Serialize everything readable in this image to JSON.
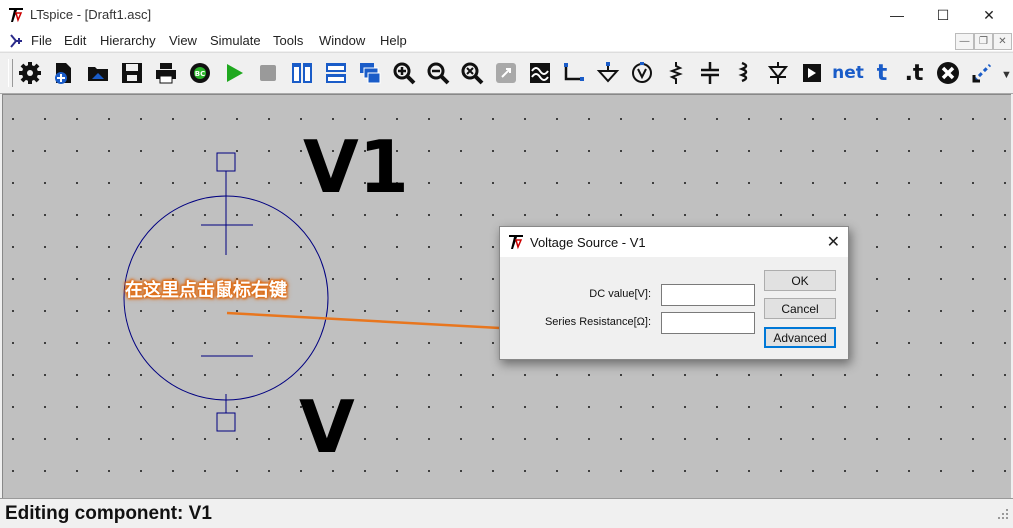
{
  "window": {
    "title": "LTspice - [Draft1.asc]"
  },
  "menu": [
    "File",
    "Edit",
    "Hierarchy",
    "View",
    "Simulate",
    "Tools",
    "Window",
    "Help"
  ],
  "toolbar": {
    "icons": [
      "gear-icon",
      "new-schematic-icon",
      "open-icon",
      "save-icon",
      "print-icon",
      "control-panel-icon",
      "run-icon",
      "stop-icon",
      "tile-vertical-icon",
      "tile-horizontal-icon",
      "cascade-icon",
      "zoom-in-icon",
      "zoom-out-icon",
      "zoom-fit-icon",
      "autorange-icon",
      "fft-icon",
      "wire-icon",
      "ground-icon",
      "label-net-icon",
      "resistor-icon",
      "capacitor-icon",
      "inductor-icon",
      "diode-icon",
      "component-icon",
      "netlist-icon",
      "text-icon",
      "spice-directive-icon",
      "delete-icon",
      "more-icon"
    ],
    "netlist_label": "net",
    "text_label": "t",
    "directive_label": ".t"
  },
  "schematic": {
    "component_name": "V1",
    "value_label": "V",
    "annotation": "在这里点击鼠标右键"
  },
  "dialog": {
    "title": "Voltage Source - V1",
    "dc_label": "DC value[V]:",
    "dc_value": "",
    "series_label": "Series Resistance[Ω]:",
    "series_value": "",
    "ok": "OK",
    "cancel": "Cancel",
    "advanced": "Advanced"
  },
  "status": {
    "text": "Editing component: V1"
  },
  "colors": {
    "accent": "#0078d7",
    "annotation": "#e8761e",
    "symbol": "#000080",
    "canvas": "#c0c0c0"
  }
}
